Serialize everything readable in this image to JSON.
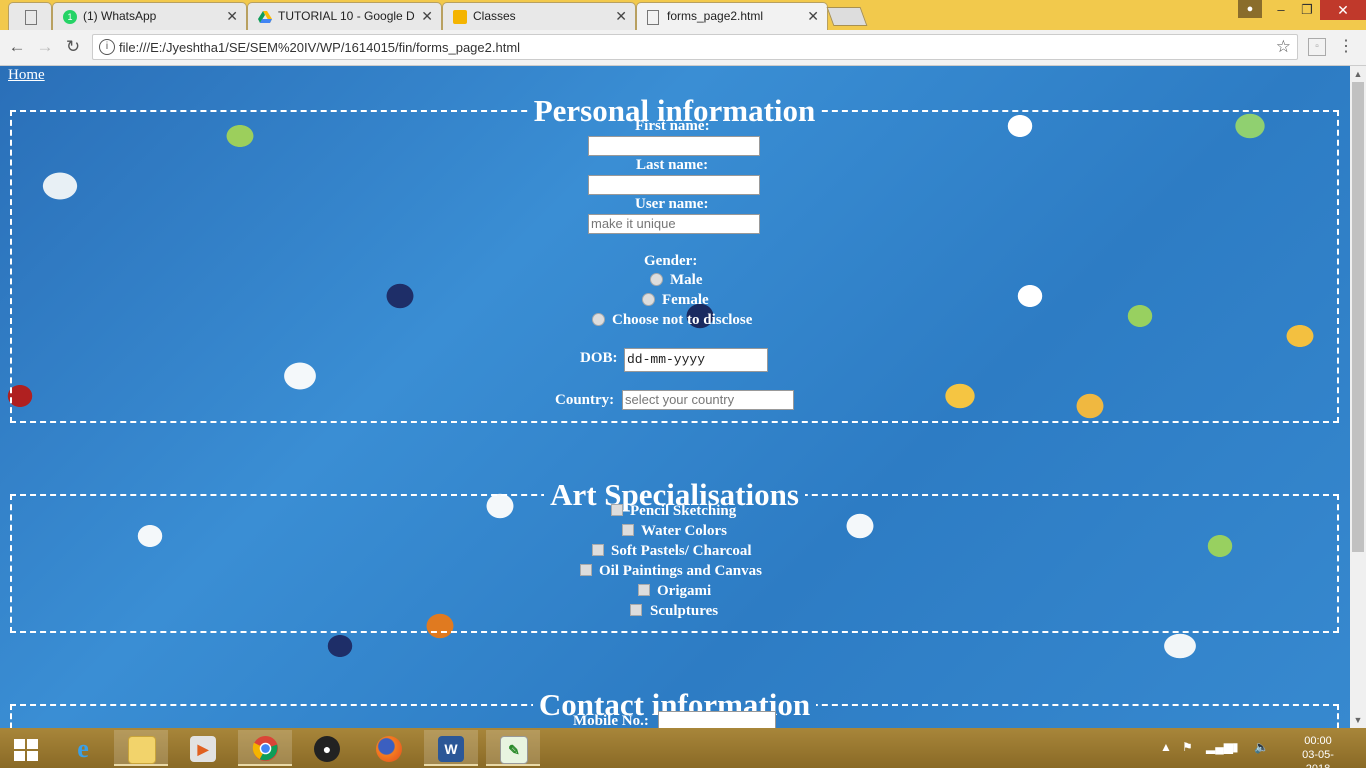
{
  "browser": {
    "tabs": [
      {
        "title": "",
        "icon": "page-icon"
      },
      {
        "title": "(1) WhatsApp",
        "icon": "whatsapp-icon"
      },
      {
        "title": "TUTORIAL 10 - Google D",
        "icon": "google-drive-icon"
      },
      {
        "title": "Classes",
        "icon": "classroom-icon"
      },
      {
        "title": "forms_page2.html",
        "icon": "page-icon",
        "active": true
      }
    ],
    "url": "file:///E:/Jyeshtha1/SE/SEM%20IV/WP/1614015/fin/forms_page2.html"
  },
  "page": {
    "home_link": "Home",
    "personal": {
      "legend": "Personal information",
      "first_name_label": "First name:",
      "last_name_label": "Last name:",
      "user_name_label": "User name:",
      "user_name_placeholder": "make it unique",
      "gender_label": "Gender:",
      "gender_options": [
        "Male",
        "Female",
        "Choose not to disclose"
      ],
      "dob_label": "DOB:",
      "dob_placeholder": "dd-mm-yyyy",
      "country_label": "Country:",
      "country_placeholder": "select your country"
    },
    "art": {
      "legend": "Art Specialisations",
      "options": [
        "Pencil Sketching",
        "Water Colors",
        "Soft Pastels/ Charcoal",
        "Oil Paintings and Canvas",
        "Origami",
        "Sculptures"
      ]
    },
    "contact": {
      "legend": "Contact information",
      "mobile_label": "Mobile No.:"
    }
  },
  "taskbar": {
    "time": "00:00",
    "date": "03-05-2018"
  }
}
